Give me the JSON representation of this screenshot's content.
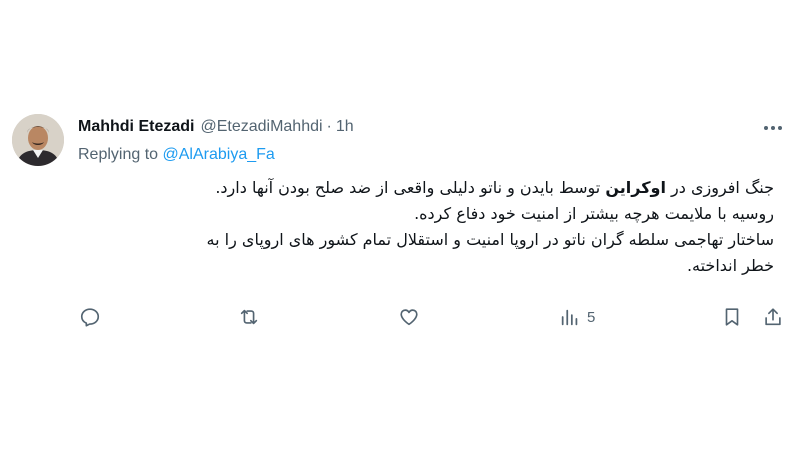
{
  "author": {
    "name": "Mahhdi Etezadi",
    "handle": "@EtezadiMahhdi",
    "separator": "·",
    "time": "1h"
  },
  "reply": {
    "prefix": "Replying to",
    "mention": "@AlArabiya_Fa"
  },
  "content": {
    "line1_start": "جنگ افروزی در",
    "line1_bold": "اوکراین",
    "line1_end": "توسط بایدن و ناتو دلیلی واقعی از ضد صلح بودن آنها دارد.",
    "line2": "روسیه با ملایمت هرچه بیشتر از امنیت خود دفاع کرده.",
    "line3": "ساختار تهاجمی سلطه گران ناتو در اروپا امنیت و استقلال تمام کشور های اروپای را به",
    "line4": "خطر انداخته."
  },
  "actions": {
    "reply_icon": "reply-icon",
    "retweet_icon": "retweet-icon",
    "like_icon": "heart-icon",
    "views_icon": "analytics-icon",
    "views_count": "5",
    "bookmark_icon": "bookmark-icon",
    "share_icon": "share-icon"
  },
  "colors": {
    "text": "#0f1419",
    "muted": "#536471",
    "link": "#1d9bf0"
  }
}
